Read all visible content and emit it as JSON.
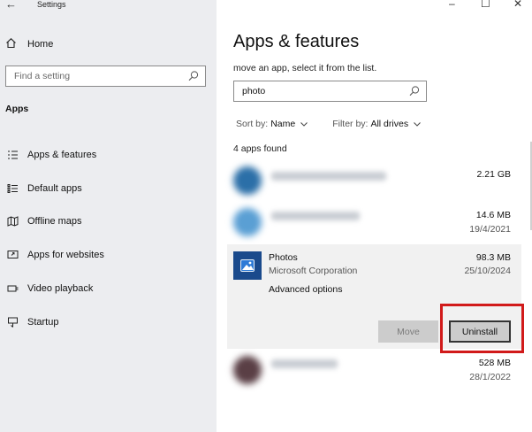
{
  "window": {
    "title": "Settings",
    "back_glyph": "←",
    "minimize_glyph": "–",
    "maximize_glyph": "☐",
    "close_glyph": "✕"
  },
  "sidebar": {
    "home_label": "Home",
    "home_icon": "home-icon",
    "search_placeholder": "Find a setting",
    "section_label": "Apps",
    "items": [
      {
        "label": "Apps & features",
        "icon": "apps-features-icon"
      },
      {
        "label": "Default apps",
        "icon": "default-apps-icon"
      },
      {
        "label": "Offline maps",
        "icon": "offline-maps-icon"
      },
      {
        "label": "Apps for websites",
        "icon": "apps-for-websites-icon"
      },
      {
        "label": "Video playback",
        "icon": "video-playback-icon"
      },
      {
        "label": "Startup",
        "icon": "startup-icon"
      }
    ]
  },
  "main": {
    "title": "Apps & features",
    "subtitle": "move an app, select it from the list.",
    "search_value": "photo",
    "sort_label": "Sort by:",
    "sort_value": "Name",
    "filter_label": "Filter by:",
    "filter_value": "All drives",
    "found_text": "4 apps found",
    "apps": [
      {
        "name": "",
        "publisher": "",
        "size": "2.21 GB",
        "date": "",
        "icon_color": "#2b6fa8",
        "blurred": true
      },
      {
        "name": "",
        "publisher": "",
        "size": "14.6 MB",
        "date": "19/4/2021",
        "icon_color": "#5a9fd4",
        "blurred": true
      },
      {
        "name": "Photos",
        "publisher": "Microsoft Corporation",
        "size": "98.3 MB",
        "date": "25/10/2024",
        "icon_color": "#1a4a8c",
        "blurred": false,
        "advanced_label": "Advanced options",
        "move_label": "Move",
        "uninstall_label": "Uninstall"
      },
      {
        "name": "",
        "publisher": "",
        "size": "528 MB",
        "date": "28/1/2022",
        "icon_color": "#5a3f45",
        "blurred": true
      }
    ]
  },
  "colors": {
    "sidebar_bg": "#ecedf0",
    "expanded_bg": "#f1f1f1",
    "highlight": "#d11a1a",
    "button_bg": "#cccccc"
  }
}
